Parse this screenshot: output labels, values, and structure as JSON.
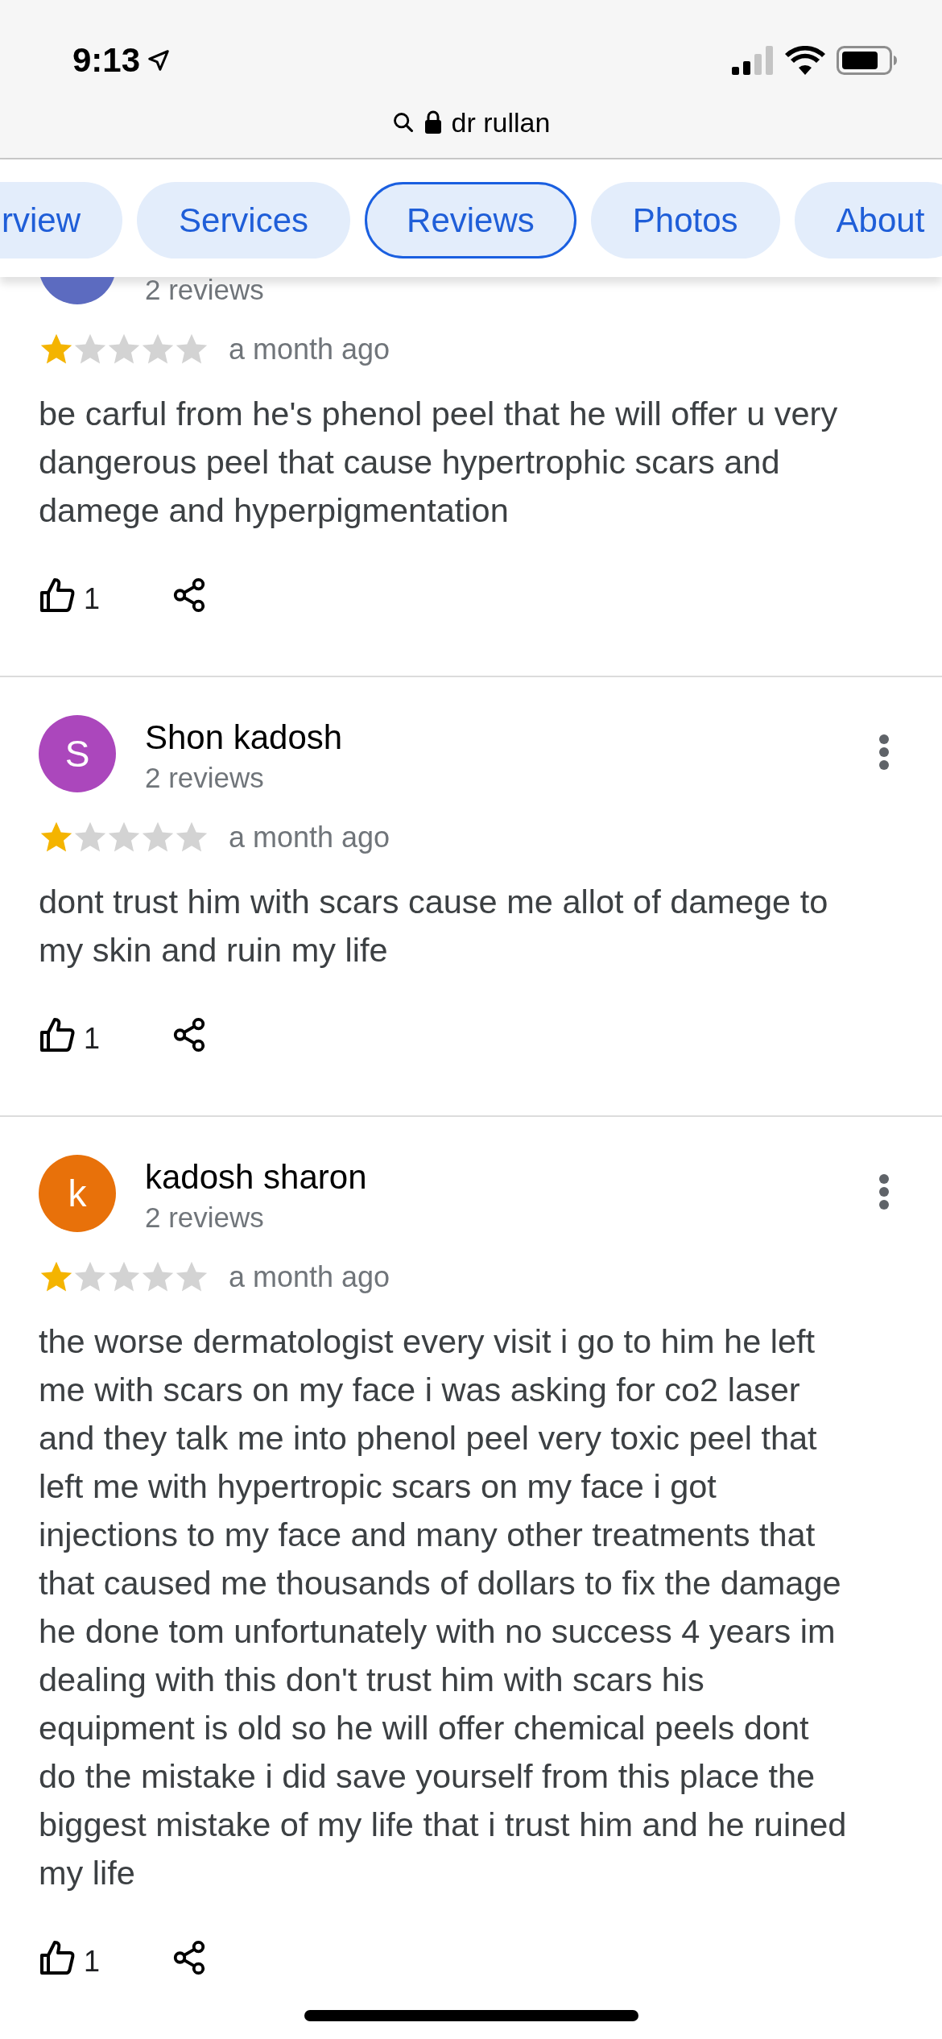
{
  "status_bar": {
    "time": "9:13"
  },
  "address_bar": {
    "query": "dr rullan"
  },
  "tabs": [
    {
      "label": "rview",
      "selected": false
    },
    {
      "label": "Services",
      "selected": false
    },
    {
      "label": "Reviews",
      "selected": true
    },
    {
      "label": "Photos",
      "selected": false
    },
    {
      "label": "About",
      "selected": false
    }
  ],
  "reviews": [
    {
      "color": "#5c6bc0",
      "review_count": "2 reviews",
      "stars": 1,
      "time": "a month ago",
      "text": "be carful from he's phenol peel that he will offer u very dangerous peel that cause hypertrophic scars and damege and hyperpigmentation",
      "likes": "1"
    },
    {
      "initial": "S",
      "color": "#ab47bc",
      "name": "Shon kadosh",
      "review_count": "2 reviews",
      "stars": 1,
      "time": "a month ago",
      "text": "dont trust him with scars cause me allot of damege to my skin and ruin my life",
      "likes": "1"
    },
    {
      "initial": "k",
      "color": "#e8710a",
      "name": "kadosh sharon",
      "review_count": "2 reviews",
      "stars": 1,
      "time": "a month ago",
      "text": "the worse dermatologist every visit i go to him he left me with scars on my face i was asking for co2 laser and they talk me into phenol peel very toxic peel that left me with hypertropic scars on my face i got injections to my face and many other treatments that that caused me thousands of dollars to fix the damage he done tom unfortunately with no success 4 years im dealing with this don't trust him with scars his equipment is old so he will offer chemical peels dont do the mistake i did save yourself from this place the biggest mistake of my life that i trust him and he ruined my life",
      "likes": "1"
    }
  ]
}
